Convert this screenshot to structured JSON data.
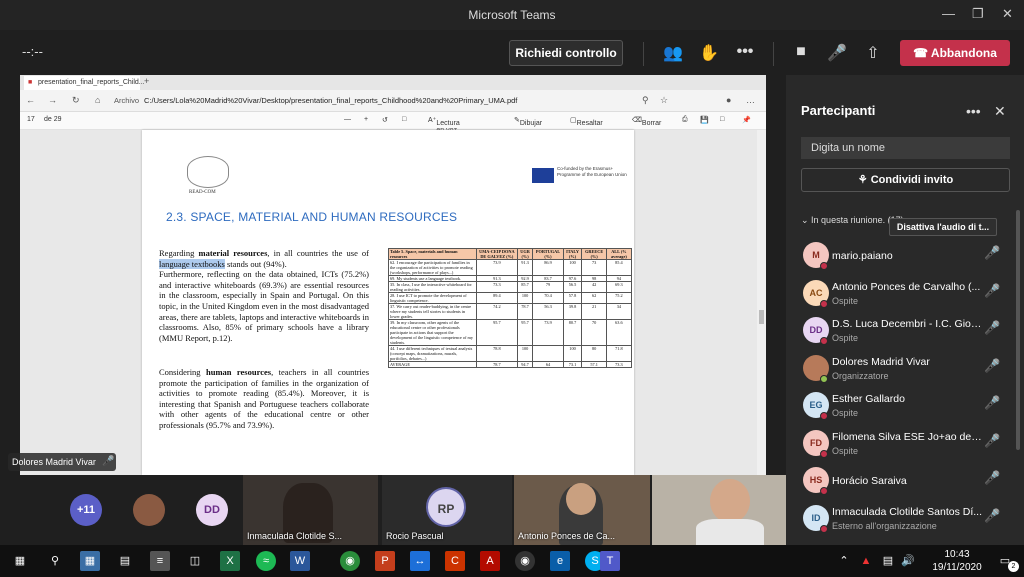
{
  "window": {
    "title": "Microsoft Teams"
  },
  "controls": {
    "timer": "--:--",
    "request_control": "Richiedi controllo",
    "leave": "Abbandona"
  },
  "browser": {
    "tab_title": "presentation_final_reports_Child...",
    "url_label": "Archivo",
    "url": "C:/Users/Lola%20Madrid%20Vivar/Desktop/presentation_final_reports_Childhood%20and%20Primary_UMA.pdf",
    "page_num": "17",
    "page_total": "de 29",
    "tools": {
      "read_aloud": "Lectura en voz alta",
      "draw": "Dibujar",
      "highlight": "Resaltar",
      "erase": "Borrar"
    }
  },
  "pdf": {
    "logo_text": "READ-COM",
    "eu_text": "Co-funded by the Erasmus+ Programme of the European Union",
    "section_title": "2.3. SPACE, MATERIAL AND HUMAN RESOURCES",
    "para1_a": "Regarding ",
    "para1_b": "material resources",
    "para1_c": ", in all countries the use of ",
    "para1_hl": "language textbooks",
    "para1_d": " stands out (94%).",
    "para1_rest": "Furthermore, reflecting on the data obtained, ICTs (75.2%) and interactive whiteboards (69.3%) are essential resources in the classroom, especially in Spain and Portugal. On this topic, in the United Kingdom even in the most disadvantaged areas, there are tablets, laptops and interactive whiteboards in classrooms. Also, 85% of primary schools have a library (MMU Report, p.12).",
    "para2_a": "Considering ",
    "para2_b": "human resources",
    "para2_c": ", teachers in all countries promote the participation of families in the organization of activities to promote reading (85.4%). Moreover, it is interesting that Spanish and Portuguese teachers collaborate with other agents of the educational centre or other professionals (95.7% and 73.9%).",
    "table": {
      "headers": [
        "Table 5. Space, materials and human resources",
        "UMA-CEIP DONA DE GALVEZ (%)",
        "UGR (%)",
        "PORTUGAL (%)",
        "ITALY (%)",
        "GREECE (%)",
        "ALL (% average)"
      ],
      "rows": [
        [
          "62. I encourage the participation of families in the organization of activities to promote reading (workshops, performance of plays...)",
          "73.9",
          "91.3",
          "86.9",
          "100",
          "73",
          "85.4"
        ],
        [
          "69. My students use a language textbook.",
          "91.3",
          "92.9",
          "83.7",
          "97.6",
          "98",
          "94"
        ],
        [
          "35. In class, I use the interactive whiteboard for reading activities.",
          "73.3",
          "85.7",
          "79",
          "56.5",
          "42",
          "69.3"
        ],
        [
          "28. I use ICT to promote the development of linguistic competence.",
          "89.4",
          "100",
          "70.4",
          "57.8",
          "62",
          "75.2"
        ],
        [
          "37. We carry out reader-buddying, in the centre where my students tell stories to students in lower grades.",
          "74.2",
          "78.7",
          "56.3",
          "39.8",
          "21",
          "34"
        ],
        [
          "39. In my classroom, other agents of the educational centre or other professionals participate in actions that support the development of the linguistic competence of my students.",
          "95.7",
          "95.7",
          "73.9",
          "80.7",
          "70",
          "63.6"
        ],
        [
          "44. I use different techniques of textual analysis (concept maps, dramatizations, murals, portfolios, debates...)",
          "78.8",
          "100",
          "",
          "100",
          "80",
          "71.8"
        ],
        [
          "AVERAGE",
          "78.7",
          "94.7",
          "64",
          "73.1",
          "57.1",
          "73.3"
        ]
      ]
    }
  },
  "presenter_label": "Dolores Madrid Vivar",
  "panel": {
    "title": "Partecipanti",
    "search_placeholder": "Digita un nome",
    "invite": "Condividi invito",
    "in_meeting": "In questa riunione. (17)",
    "mute_all": "Disattiva l'audio di t...",
    "participants": [
      {
        "initials": "M",
        "name": "mario.paiano",
        "role": "",
        "color": "#f4c6c0",
        "text_color": "#8a2a1e"
      },
      {
        "initials": "AC",
        "name": "Antonio Ponces de Carvalho (...",
        "role": "Ospite",
        "color": "#fbd9b8",
        "text_color": "#8a4a12"
      },
      {
        "initials": "DD",
        "name": "D.S. Luca Decembri - I.C. Giov...",
        "role": "Ospite",
        "color": "#e8d6f2",
        "text_color": "#6b2f88"
      },
      {
        "initials": "",
        "name": "Dolores Madrid Vivar",
        "role": "Organizzatore",
        "color": "#b77a5a",
        "text_color": "#fff"
      },
      {
        "initials": "EG",
        "name": "Esther Gallardo",
        "role": "Ospite",
        "color": "#d4e6f4",
        "text_color": "#2b5f8a"
      },
      {
        "initials": "FD",
        "name": "Filomena Silva ESE Jo+ao de ...",
        "role": "Ospite",
        "color": "#f4c6c0",
        "text_color": "#8a2a1e"
      },
      {
        "initials": "HS",
        "name": "Horácio Saraiva",
        "role": "",
        "color": "#f4c6c0",
        "text_color": "#8a2a1e"
      },
      {
        "initials": "ID",
        "name": "Inmaculada Clotilde Santos Dí...",
        "role": "Esterno all'organizzazione",
        "color": "#d4e6f4",
        "text_color": "#2b5f8a"
      }
    ]
  },
  "strip": {
    "more_count": "+11",
    "dd_initials": "DD",
    "rp_initials": "RP",
    "tile1": "Inmaculada Clotilde S...",
    "tile2": "Rocio Pascual",
    "tile3": "Antonio Ponces de Ca..."
  },
  "taskbar": {
    "time": "10:43",
    "date": "19/11/2020",
    "notif": "2"
  }
}
